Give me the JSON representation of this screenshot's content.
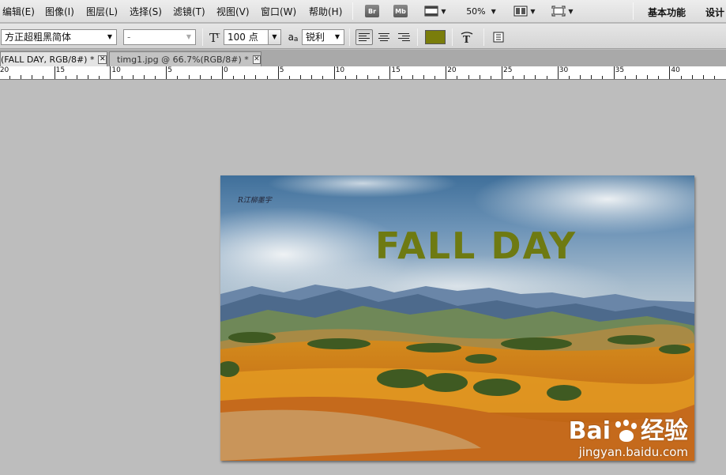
{
  "menubar": {
    "items": [
      "编辑(E)",
      "图像(I)",
      "图层(L)",
      "选择(S)",
      "滤镜(T)",
      "视图(V)",
      "窗口(W)",
      "帮助(H)"
    ],
    "bridge_label": "Br",
    "minibridge_label": "Mb",
    "zoom": "50%",
    "workspace_essentials": "基本功能",
    "workspace_design": "设计"
  },
  "options": {
    "font_family": "方正超粗黑简体",
    "font_style": "-",
    "font_size": "100 点",
    "aa_icon_label": "a",
    "antialias_prefix": "a",
    "antialias": "锐利",
    "text_color": "#7a7d0b"
  },
  "tabs": [
    {
      "label": "(FALL DAY, RGB/8#) *",
      "active": true
    },
    {
      "label": "timg1.jpg @ 66.7%(RGB/8#) *",
      "active": false
    }
  ],
  "ruler": {
    "labels": [
      "20",
      "15",
      "10",
      "5",
      "0",
      "5",
      "10",
      "15",
      "20",
      "25",
      "30",
      "35",
      "40"
    ]
  },
  "document": {
    "title_text": "FALL DAY",
    "title_color": "#6e7a12",
    "signature": "R江柳墨宇",
    "watermark_brand": "Bai",
    "watermark_brand_suffix": "经验",
    "watermark_url": "jingyan.baidu.com"
  }
}
